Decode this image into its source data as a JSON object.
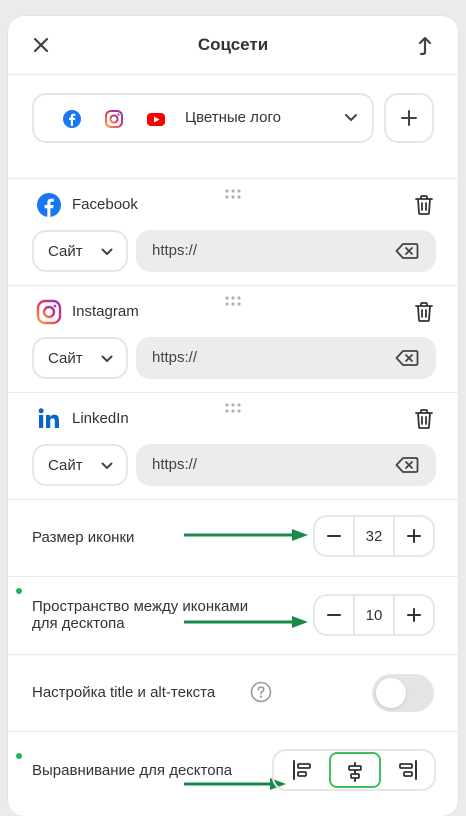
{
  "header": {
    "title": "Соцсети"
  },
  "style_select": {
    "label": "Цветные лого"
  },
  "networks": [
    {
      "name": "Facebook",
      "type_label": "Сайт",
      "url_value": "https://"
    },
    {
      "name": "Instagram",
      "type_label": "Сайт",
      "url_value": "https://"
    },
    {
      "name": "LinkedIn",
      "type_label": "Сайт",
      "url_value": "https://"
    }
  ],
  "icon_size": {
    "label": "Размер иконки",
    "value": "32"
  },
  "spacing": {
    "label_line1": "Пространство между иконками",
    "label_line2": "для десктопа",
    "value": "10"
  },
  "title_alt": {
    "label": "Настройка title и alt-текста",
    "enabled": false
  },
  "alignment": {
    "label": "Выравнивание для десктопа",
    "options": [
      "left",
      "center",
      "right"
    ],
    "selected": "center"
  },
  "colors": {
    "accent_green": "#1a8a4c",
    "active_border": "#3fbf5d",
    "facebook": "#1877f2",
    "youtube": "#ff0000",
    "linkedin": "#0a66c2"
  }
}
